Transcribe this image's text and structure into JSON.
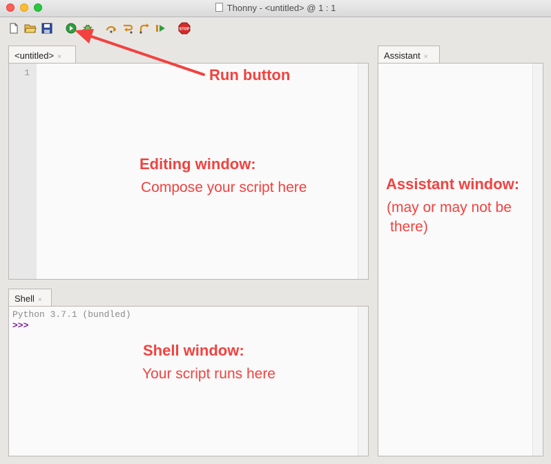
{
  "window": {
    "title": "Thonny  -  <untitled>  @  1 : 1"
  },
  "toolbar": {
    "buttons": [
      "new-file",
      "open-file",
      "save-file",
      "run",
      "debug",
      "step-over",
      "step-into",
      "step-out",
      "resume",
      "stop"
    ],
    "stop_label": "STOP"
  },
  "editor": {
    "tab_label": "<untitled>",
    "tab_close": "×",
    "line_number": "1"
  },
  "shell": {
    "tab_label": "Shell",
    "tab_close": "×",
    "banner": "Python 3.7.1 (bundled)",
    "prompt": ">>>"
  },
  "assistant": {
    "tab_label": "Assistant",
    "tab_close": "×"
  },
  "annotations": {
    "run_button": "Run button",
    "editing_title": "Editing window:",
    "editing_sub": "Compose your script here",
    "shell_title": "Shell window:",
    "shell_sub": "Your script runs here",
    "assistant_title": "Assistant window:",
    "assistant_sub1": "(may or may not be",
    "assistant_sub2": "there)"
  },
  "colors": {
    "annotation": "#f2423f",
    "prompt": "#7b1fa2",
    "run_green": "#2e9e3e"
  }
}
